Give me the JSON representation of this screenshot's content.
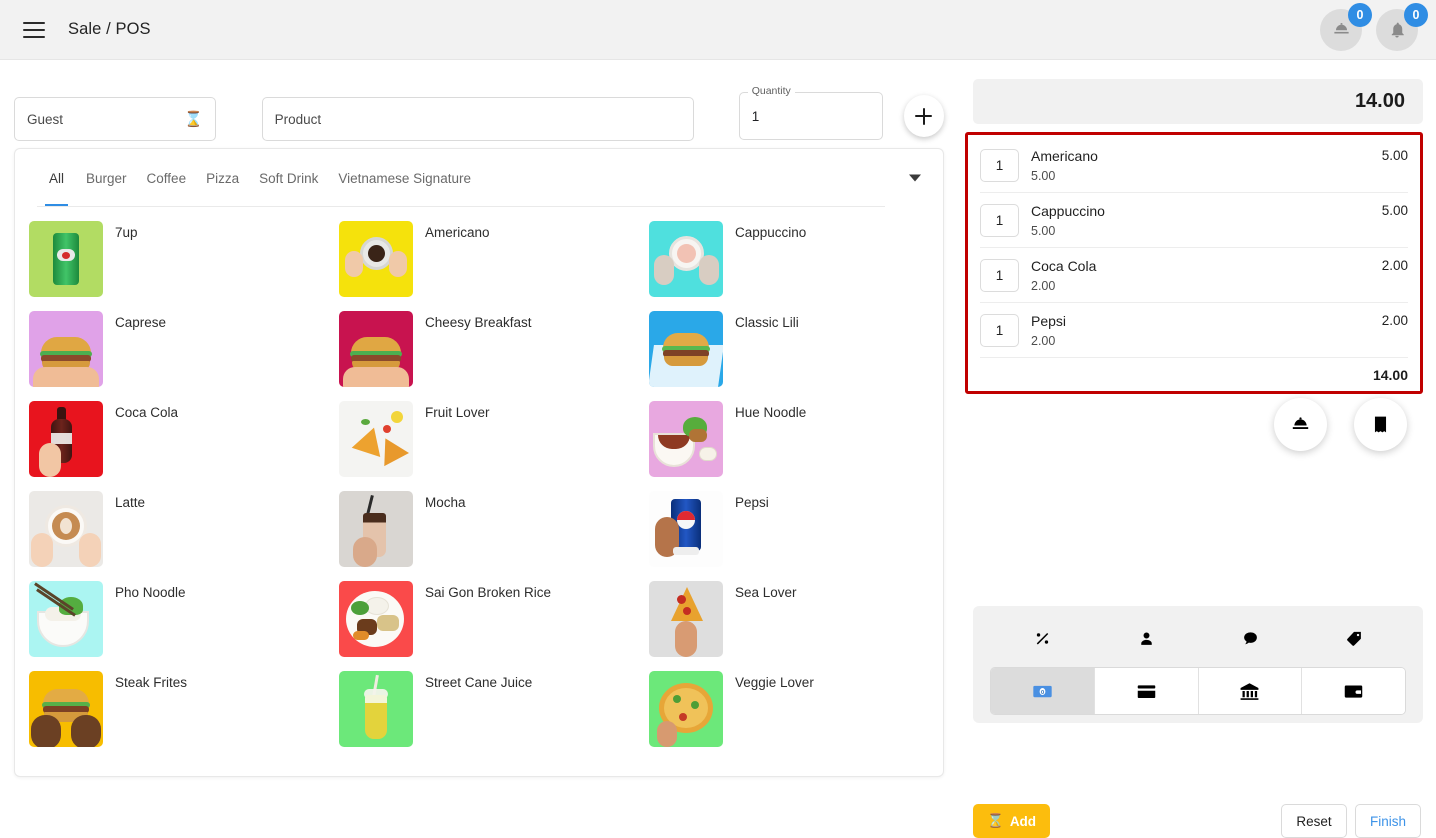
{
  "header": {
    "menu_icon": "hamburger-menu-icon",
    "title": "Sale / POS",
    "actions": [
      {
        "icon": "service-bell-icon",
        "badge": "0"
      },
      {
        "icon": "notification-bell-icon",
        "badge": "0"
      }
    ]
  },
  "form": {
    "guest": {
      "label": "Guest",
      "value": "",
      "placeholder": "Guest",
      "trailing_icon": "hourglass-icon"
    },
    "product": {
      "label": "Product",
      "value": "",
      "placeholder": "Product"
    },
    "quantity": {
      "label": "Quantity",
      "value": "1"
    },
    "add_icon": "plus-icon"
  },
  "catalog": {
    "tabs": [
      {
        "label": "All",
        "active": true
      },
      {
        "label": "Burger",
        "active": false
      },
      {
        "label": "Coffee",
        "active": false
      },
      {
        "label": "Pizza",
        "active": false
      },
      {
        "label": "Soft Drink",
        "active": false
      },
      {
        "label": "Vietnamese Signature",
        "active": false
      }
    ],
    "more_icon": "chevron-down-icon",
    "products": [
      {
        "name": "7up",
        "bg": "#b2dc63",
        "art": "can-green"
      },
      {
        "name": "Americano",
        "bg": "#f5e20c",
        "art": "coffee-cup"
      },
      {
        "name": "Cappuccino",
        "bg": "#4fe0de",
        "art": "coffee-cup-pink"
      },
      {
        "name": "Caprese",
        "bg": "#e0a2e8",
        "art": "burger"
      },
      {
        "name": "Cheesy Breakfast",
        "bg": "#c8134f",
        "art": "burger"
      },
      {
        "name": "Classic Lili",
        "bg": "#2aa8e8",
        "art": "burger-tray"
      },
      {
        "name": "Coca Cola",
        "bg": "#e8141e",
        "art": "bottle-dark"
      },
      {
        "name": "Fruit Lover",
        "bg": "#f4f4f2",
        "art": "pizza-slices"
      },
      {
        "name": "Hue Noodle",
        "bg": "#e8a8e0",
        "art": "noodle-bowl"
      },
      {
        "name": "Latte",
        "bg": "#ebe9e6",
        "art": "latte-cup"
      },
      {
        "name": "Mocha",
        "bg": "#d9d6d2",
        "art": "shake-glass"
      },
      {
        "name": "Pepsi",
        "bg": "#fdfdfd",
        "art": "can-blue"
      },
      {
        "name": "Pho Noodle",
        "bg": "#abf5f2",
        "art": "pho-bowl"
      },
      {
        "name": "Sai Gon Broken Rice",
        "bg": "#fa4a4a",
        "art": "rice-plate"
      },
      {
        "name": "Sea Lover",
        "bg": "#dedede",
        "art": "pizza-slice-hand"
      },
      {
        "name": "Steak Frites",
        "bg": "#f7bd00",
        "art": "burger-hands"
      },
      {
        "name": "Street Cane Juice",
        "bg": "#6ce87a",
        "art": "juice-cup"
      },
      {
        "name": "Veggie Lover",
        "bg": "#6ce87a",
        "art": "pizza-whole"
      }
    ]
  },
  "order": {
    "grand_total": "14.00",
    "items": [
      {
        "qty": "1",
        "name": "Americano",
        "unit_price": "5.00",
        "amount": "5.00"
      },
      {
        "qty": "1",
        "name": "Cappuccino",
        "unit_price": "5.00",
        "amount": "5.00"
      },
      {
        "qty": "1",
        "name": "Coca Cola",
        "unit_price": "2.00",
        "amount": "2.00"
      },
      {
        "qty": "1",
        "name": "Pepsi",
        "unit_price": "2.00",
        "amount": "2.00"
      }
    ],
    "subtotal": "14.00",
    "highlight_color": "#c00000"
  },
  "quick_actions": [
    {
      "icon": "service-bell-icon"
    },
    {
      "icon": "receipt-icon"
    }
  ],
  "payment": {
    "option_icons": [
      {
        "icon": "percent-discount-icon"
      },
      {
        "icon": "customer-person-icon"
      },
      {
        "icon": "comment-note-icon"
      },
      {
        "icon": "tag-coupon-icon"
      }
    ],
    "methods": [
      {
        "icon": "cash-banknote-icon",
        "selected": true
      },
      {
        "icon": "credit-card-icon",
        "selected": false
      },
      {
        "icon": "bank-icon",
        "selected": false
      },
      {
        "icon": "wallet-icon",
        "selected": false
      }
    ]
  },
  "footer": {
    "add_label": "Add",
    "add_icon": "hourglass-icon",
    "reset_label": "Reset",
    "finish_label": "Finish",
    "add_color": "#fcbd0d",
    "finish_color": "#3d93e8"
  }
}
